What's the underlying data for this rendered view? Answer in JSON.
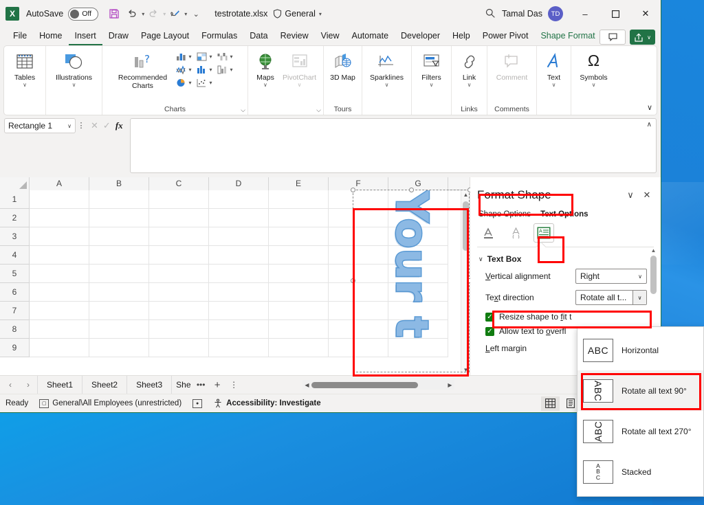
{
  "titlebar": {
    "app_icon": "excel-logo",
    "app_letter": "X",
    "autosave_label": "AutoSave",
    "autosave_state": "Off",
    "save_icon": "save-icon",
    "undo_icon": "undo-icon",
    "redo_icon": "redo-icon",
    "touchpen_icon": "pen-icon",
    "customize_icon": "customize-quick-access-icon",
    "filename": "testrotate.xlsx",
    "sensitivity_label": "General",
    "sensitivity_icon": "shield-icon",
    "search_icon": "search-icon",
    "user_name": "Tamal Das",
    "user_initials": "TD",
    "minimize": "–",
    "maximize": "☐",
    "close": "✕"
  },
  "tabs": [
    {
      "label": "File",
      "active": false
    },
    {
      "label": "Home",
      "active": false
    },
    {
      "label": "Insert",
      "active": true
    },
    {
      "label": "Draw",
      "active": false
    },
    {
      "label": "Page Layout",
      "active": false
    },
    {
      "label": "Formulas",
      "active": false
    },
    {
      "label": "Data",
      "active": false
    },
    {
      "label": "Review",
      "active": false
    },
    {
      "label": "View",
      "active": false
    },
    {
      "label": "Automate",
      "active": false
    },
    {
      "label": "Developer",
      "active": false
    },
    {
      "label": "Help",
      "active": false
    },
    {
      "label": "Power Pivot",
      "active": false
    },
    {
      "label": "Shape Format",
      "active": false,
      "contextual": true
    }
  ],
  "tabrow_right": {
    "comments_label": "",
    "comments_icon": "comment-icon",
    "share_label": "",
    "share_icon": "share-icon",
    "share_caret": "∨"
  },
  "ribbon": {
    "groups": [
      {
        "name": "tables",
        "label": "",
        "buttons": [
          {
            "label": "Tables",
            "dropdown": "∨",
            "icon": "table-icon"
          }
        ]
      },
      {
        "name": "illustrations",
        "label": "",
        "buttons": [
          {
            "label": "Illustrations",
            "dropdown": "∨",
            "icon": "illustrations-icon"
          }
        ]
      },
      {
        "name": "charts",
        "label": "Charts",
        "buttons": [
          {
            "label": "Recommended Charts",
            "dropdown": "",
            "icon": "recommended-charts-icon"
          }
        ],
        "chart_icons": [
          "column-chart-icon",
          "waterfall-chart-icon",
          "pie-chart-icon",
          "hierarchy-chart-icon",
          "bar-chart-icon",
          "scatter-chart-icon",
          "stock-chart-icon",
          "combo-chart-icon"
        ]
      },
      {
        "name": "tours",
        "label": "Tours",
        "buttons": [
          {
            "label": "Maps",
            "dropdown": "∨",
            "icon": "maps-icon"
          },
          {
            "label": "PivotChart",
            "dropdown": "∨",
            "icon": "pivotchart-icon",
            "disabled": true
          }
        ]
      },
      {
        "name": "tours2",
        "label": "Tours",
        "buttons": [
          {
            "label": "3D Map",
            "dropdown": "∨",
            "icon": "3d-map-icon"
          }
        ]
      },
      {
        "name": "sparklines",
        "label": "",
        "buttons": [
          {
            "label": "Sparklines",
            "dropdown": "∨",
            "icon": "sparklines-icon"
          }
        ]
      },
      {
        "name": "filters",
        "label": "",
        "buttons": [
          {
            "label": "Filters",
            "dropdown": "∨",
            "icon": "filters-icon"
          }
        ]
      },
      {
        "name": "links",
        "label": "Links",
        "buttons": [
          {
            "label": "Link",
            "dropdown": "∨",
            "icon": "link-icon"
          }
        ]
      },
      {
        "name": "comments",
        "label": "Comments",
        "buttons": [
          {
            "label": "Comment",
            "dropdown": "",
            "icon": "comment-icon",
            "disabled": true
          }
        ]
      },
      {
        "name": "text",
        "label": "",
        "buttons": [
          {
            "label": "Text",
            "dropdown": "∨",
            "icon": "text-icon"
          }
        ]
      },
      {
        "name": "symbols",
        "label": "",
        "buttons": [
          {
            "label": "Symbols",
            "dropdown": "∨",
            "icon": "omega-icon"
          }
        ]
      }
    ],
    "group_labels": {
      "tables": "",
      "illustrations": "",
      "charts": "Charts",
      "tours": "Tours",
      "links": "Links",
      "comments": "Comments"
    },
    "collapse_icon": "∨"
  },
  "formulabar": {
    "namebox_value": "Rectangle 1",
    "namebox_caret": "∨",
    "more_icon": "⋮",
    "cancel_icon": "✕",
    "enter_icon": "✓",
    "fx_label": "fx",
    "formula_value": "",
    "expand_icon": "∧"
  },
  "grid": {
    "columns": [
      "A",
      "B",
      "C",
      "D",
      "E",
      "F",
      "G"
    ],
    "rows": [
      "1",
      "2",
      "3",
      "4",
      "5",
      "6",
      "7",
      "8",
      "9"
    ],
    "shape": {
      "name": "Rectangle 1",
      "text": "Your t",
      "text_color": "#8cb9e4",
      "outline_color": "#5b9bd5",
      "rotation": "90"
    },
    "scroll_up_icon": "▲",
    "scroll_down_icon": "▼"
  },
  "pane": {
    "title": "Format Shape",
    "collapse_icon": "∨",
    "close_icon": "✕",
    "tabs": [
      {
        "label": "Shape Options",
        "selected": false
      },
      {
        "label": "Text Options",
        "selected": true
      }
    ],
    "icons": [
      {
        "name": "text-fill-outline-icon",
        "glyph": "A",
        "selected": false
      },
      {
        "name": "text-effects-icon",
        "glyph": "Ⓐ",
        "selected": false
      },
      {
        "name": "textbox-layout-icon",
        "glyph": "≡",
        "selected": true
      }
    ],
    "section": {
      "title": "Text Box",
      "chevron": "∨",
      "rows": [
        {
          "label": "Vertical alignment",
          "label_mnemonic": "V",
          "value": "Right",
          "caret": "∨"
        },
        {
          "label": "Text direction",
          "label_mnemonic": "x",
          "value": "Rotate all t...",
          "caret": "∨"
        }
      ],
      "checkboxes": [
        {
          "label": "Resize shape to fit t",
          "checked": true,
          "check": "✓"
        },
        {
          "label": "Allow text to overfl",
          "checked": true,
          "check": "✓"
        }
      ],
      "margin_label": "Left margin"
    },
    "scroll_up": "▲",
    "scroll_down": "▼"
  },
  "dropdown": {
    "items": [
      {
        "label": "Horizontal",
        "thumb": "ABC",
        "style": "horizontal",
        "highlighted": false
      },
      {
        "label": "Rotate all text 90°",
        "thumb": "ABC",
        "style": "rot90",
        "highlighted": true
      },
      {
        "label": "Rotate all text 270°",
        "thumb": "ABC",
        "style": "rot270",
        "highlighted": false
      },
      {
        "label": "Stacked",
        "thumb": "A B C",
        "style": "stacked",
        "highlighted": false
      }
    ]
  },
  "sheettabs": {
    "prev_icon": "‹",
    "next_icon": "›",
    "sheets": [
      "Sheet1",
      "Sheet2",
      "Sheet3",
      "She"
    ],
    "overflow_icon": "•••",
    "add_icon": "+",
    "menu_icon": "⋮",
    "hscroll_left": "◀",
    "hscroll_right": "▶"
  },
  "statusbar": {
    "mode": "Ready",
    "label_icon": "label-icon",
    "label_text": "General\\All Employees (unrestricted)",
    "macro_icon": "record-macro-icon",
    "accessibility_icon": "accessibility-icon",
    "accessibility_text": "Accessibility: Investigate",
    "views": [
      {
        "name": "normal-view",
        "glyph": "⊞",
        "selected": true
      },
      {
        "name": "page-layout-view",
        "glyph": "▤",
        "selected": false
      },
      {
        "name": "page-break-preview",
        "glyph": "⌸",
        "selected": false
      }
    ],
    "zoom_out": "–"
  },
  "annotations": {
    "color": "#ff0000",
    "boxes": [
      "format-shape-title",
      "textbox-layout-icon",
      "text-direction-row",
      "shape-on-grid",
      "rotate-90-menu-item"
    ]
  }
}
